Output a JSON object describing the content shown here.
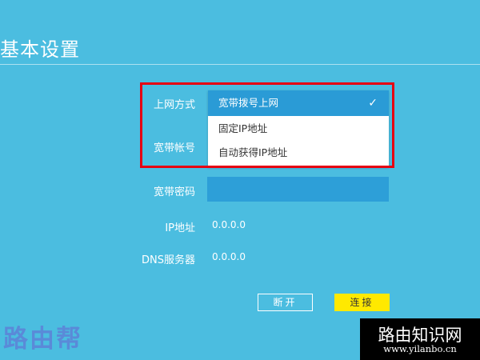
{
  "page": {
    "title": "基本设置"
  },
  "form": {
    "connection_type": {
      "label": "上网方式",
      "options": [
        "宽带拨号上网",
        "固定IP地址",
        "自动获得IP地址"
      ],
      "selected_index": 0
    },
    "account": {
      "label": "宽带帐号"
    },
    "password": {
      "label": "宽带密码",
      "value": ""
    },
    "ip_address": {
      "label": "IP地址",
      "value": "0.0.0.0"
    },
    "dns_server": {
      "label": "DNS服务器",
      "value": "0.0.0.0"
    }
  },
  "buttons": {
    "disconnect_label": "断开",
    "connect_label": "连接"
  },
  "watermarks": {
    "left_text": "路由帮",
    "right_title": "路由知识网",
    "right_url": "www.yilanbo.cn"
  },
  "colors": {
    "background": "#4bbde0",
    "selected_option": "#2a9bd6",
    "highlight_border": "#e60012",
    "connect_button": "#ffe900",
    "password_field": "#2d9fd8"
  },
  "icons": {
    "selected_check": "check-icon"
  }
}
